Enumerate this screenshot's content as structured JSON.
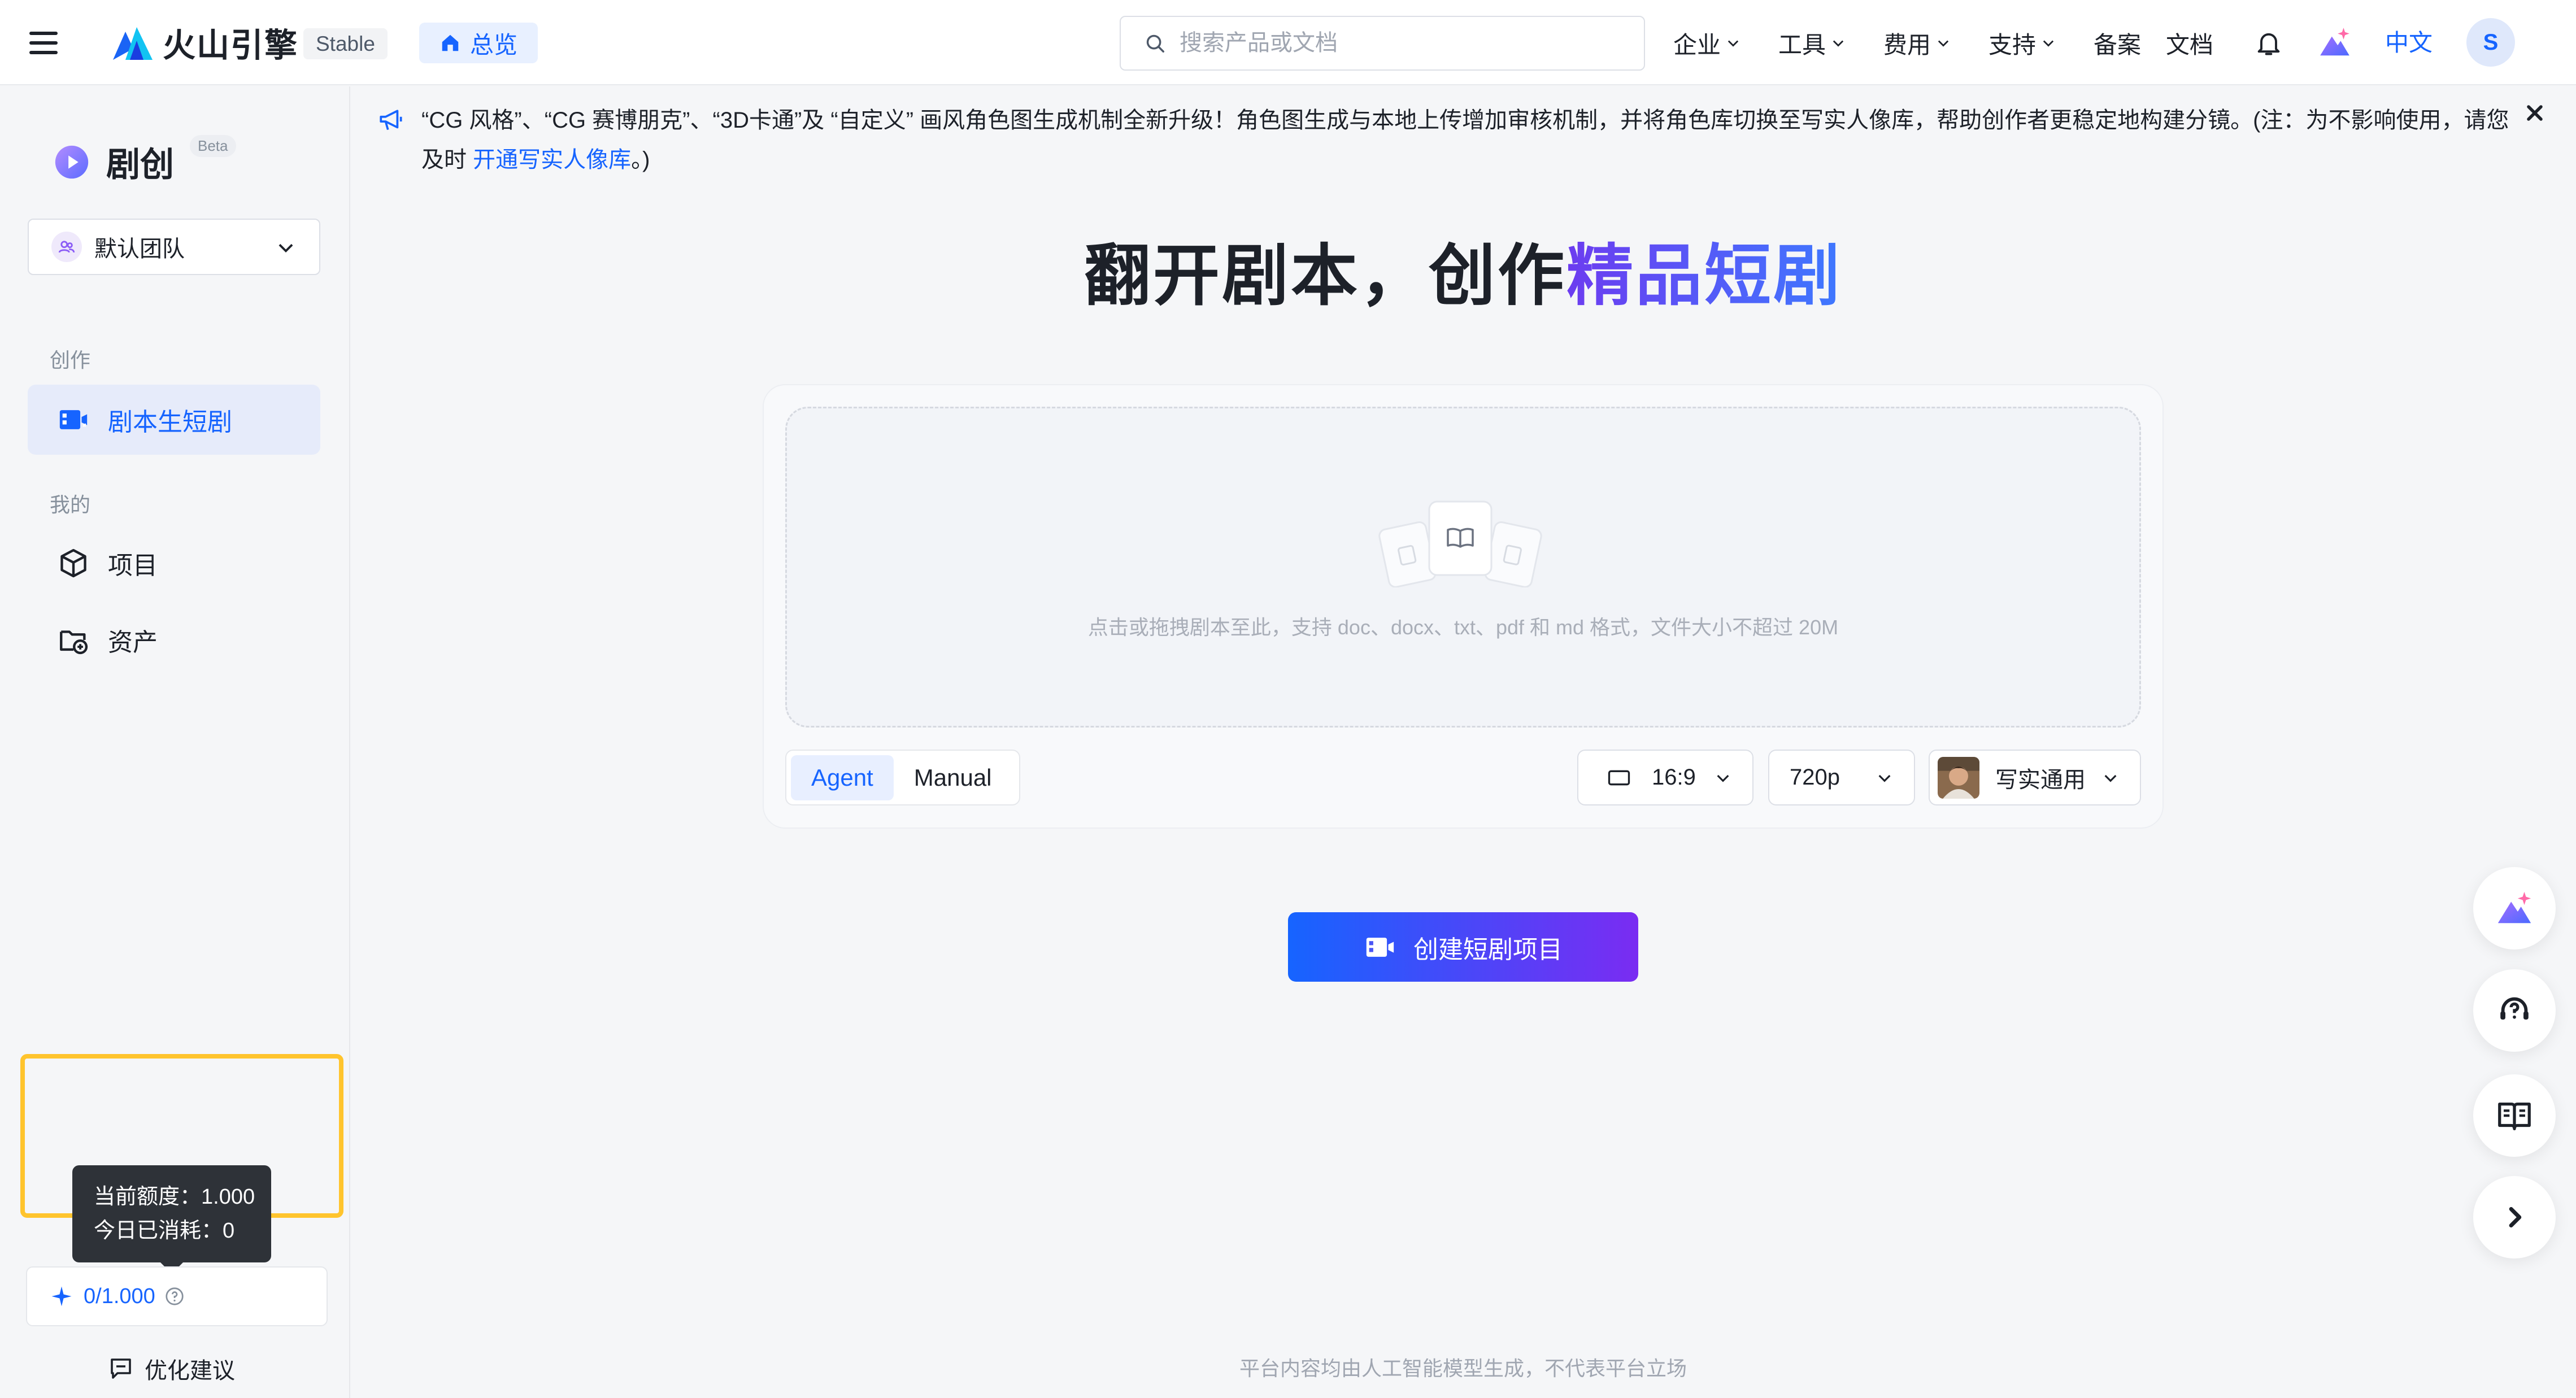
{
  "topbar": {
    "brand": "火山引擎",
    "env_tag": "Stable",
    "home_tab": "总览",
    "search_placeholder": "搜索产品或文档",
    "nav": [
      "企业",
      "工具",
      "费用",
      "支持",
      "备案",
      "文档"
    ],
    "lang": "中文",
    "avatar": "S"
  },
  "sidebar": {
    "app_name": "剧创",
    "beta": "Beta",
    "team": "默认团队",
    "section_create": "创作",
    "item_script_to_drama": "剧本生短剧",
    "section_mine": "我的",
    "item_projects": "项目",
    "item_assets": "资产",
    "quota_tooltip_line1": "当前额度：1.000",
    "quota_tooltip_line2": "今日已消耗：0",
    "quota_value": "0/1.000",
    "feedback": "优化建议"
  },
  "notice": {
    "text": "“CG 风格”、“CG 赛博朋克”、“3D卡通”及 “自定义” 画风角色图生成机制全新升级！角色图生成与本地上传增加审核机制，并将角色库切换至写实人像库，帮助创作者更稳定地构建分镜。(注：为不影响使用，请您及时 ",
    "link": "开通写实人像库",
    "tail": "。)"
  },
  "hero": {
    "prefix": "翻开剧本，创作",
    "accent": "精品短剧"
  },
  "upload": {
    "hint": "点击或拖拽剧本至此，支持 doc、docx、txt、pdf 和 md 格式，文件大小不超过 20M"
  },
  "modes": [
    "Agent",
    "Manual"
  ],
  "options": {
    "ratio": "16:9",
    "resolution": "720p",
    "style": "写实通用"
  },
  "create_button": "创建短剧项目",
  "footer_note": "平台内容均由人工智能模型生成，不代表平台立场",
  "colors": {
    "primary": "#1664ff",
    "accent_purple": "#7a2cf2",
    "highlight_border": "#ffc42d"
  }
}
